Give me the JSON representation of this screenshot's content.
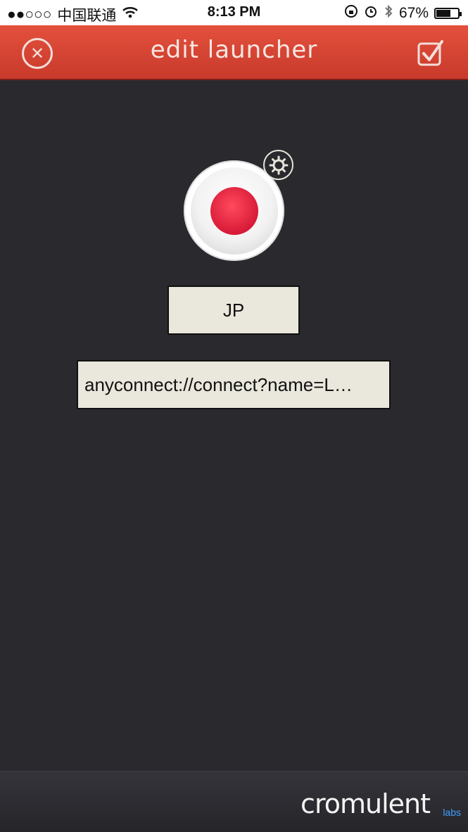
{
  "status_bar": {
    "signal": "●●○○○",
    "carrier": "中国联通",
    "time": "8:13 PM",
    "battery_percent": "67%",
    "battery_level": 0.67
  },
  "header": {
    "title": "edit launcher"
  },
  "launcher": {
    "name_value": "JP",
    "url_value": "anyconnect://connect?name=L…"
  },
  "footer": {
    "brand_main": "cromulent",
    "brand_sub": "labs"
  },
  "colors": {
    "header_red": "#d8473a",
    "background": "#2a292e",
    "field_bg": "#eae7dc",
    "flag_red": "#e2233f"
  }
}
